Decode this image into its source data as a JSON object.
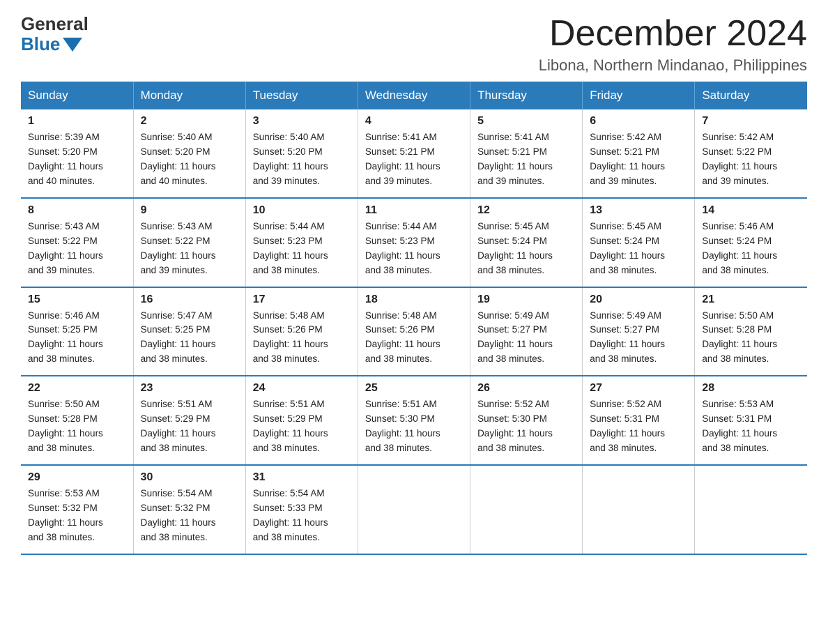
{
  "header": {
    "logo_general": "General",
    "logo_blue": "Blue",
    "title": "December 2024",
    "subtitle": "Libona, Northern Mindanao, Philippines"
  },
  "days_of_week": [
    "Sunday",
    "Monday",
    "Tuesday",
    "Wednesday",
    "Thursday",
    "Friday",
    "Saturday"
  ],
  "weeks": [
    [
      {
        "day": "1",
        "sunrise": "5:39 AM",
        "sunset": "5:20 PM",
        "daylight": "11 hours and 40 minutes."
      },
      {
        "day": "2",
        "sunrise": "5:40 AM",
        "sunset": "5:20 PM",
        "daylight": "11 hours and 40 minutes."
      },
      {
        "day": "3",
        "sunrise": "5:40 AM",
        "sunset": "5:20 PM",
        "daylight": "11 hours and 39 minutes."
      },
      {
        "day": "4",
        "sunrise": "5:41 AM",
        "sunset": "5:21 PM",
        "daylight": "11 hours and 39 minutes."
      },
      {
        "day": "5",
        "sunrise": "5:41 AM",
        "sunset": "5:21 PM",
        "daylight": "11 hours and 39 minutes."
      },
      {
        "day": "6",
        "sunrise": "5:42 AM",
        "sunset": "5:21 PM",
        "daylight": "11 hours and 39 minutes."
      },
      {
        "day": "7",
        "sunrise": "5:42 AM",
        "sunset": "5:22 PM",
        "daylight": "11 hours and 39 minutes."
      }
    ],
    [
      {
        "day": "8",
        "sunrise": "5:43 AM",
        "sunset": "5:22 PM",
        "daylight": "11 hours and 39 minutes."
      },
      {
        "day": "9",
        "sunrise": "5:43 AM",
        "sunset": "5:22 PM",
        "daylight": "11 hours and 39 minutes."
      },
      {
        "day": "10",
        "sunrise": "5:44 AM",
        "sunset": "5:23 PM",
        "daylight": "11 hours and 38 minutes."
      },
      {
        "day": "11",
        "sunrise": "5:44 AM",
        "sunset": "5:23 PM",
        "daylight": "11 hours and 38 minutes."
      },
      {
        "day": "12",
        "sunrise": "5:45 AM",
        "sunset": "5:24 PM",
        "daylight": "11 hours and 38 minutes."
      },
      {
        "day": "13",
        "sunrise": "5:45 AM",
        "sunset": "5:24 PM",
        "daylight": "11 hours and 38 minutes."
      },
      {
        "day": "14",
        "sunrise": "5:46 AM",
        "sunset": "5:24 PM",
        "daylight": "11 hours and 38 minutes."
      }
    ],
    [
      {
        "day": "15",
        "sunrise": "5:46 AM",
        "sunset": "5:25 PM",
        "daylight": "11 hours and 38 minutes."
      },
      {
        "day": "16",
        "sunrise": "5:47 AM",
        "sunset": "5:25 PM",
        "daylight": "11 hours and 38 minutes."
      },
      {
        "day": "17",
        "sunrise": "5:48 AM",
        "sunset": "5:26 PM",
        "daylight": "11 hours and 38 minutes."
      },
      {
        "day": "18",
        "sunrise": "5:48 AM",
        "sunset": "5:26 PM",
        "daylight": "11 hours and 38 minutes."
      },
      {
        "day": "19",
        "sunrise": "5:49 AM",
        "sunset": "5:27 PM",
        "daylight": "11 hours and 38 minutes."
      },
      {
        "day": "20",
        "sunrise": "5:49 AM",
        "sunset": "5:27 PM",
        "daylight": "11 hours and 38 minutes."
      },
      {
        "day": "21",
        "sunrise": "5:50 AM",
        "sunset": "5:28 PM",
        "daylight": "11 hours and 38 minutes."
      }
    ],
    [
      {
        "day": "22",
        "sunrise": "5:50 AM",
        "sunset": "5:28 PM",
        "daylight": "11 hours and 38 minutes."
      },
      {
        "day": "23",
        "sunrise": "5:51 AM",
        "sunset": "5:29 PM",
        "daylight": "11 hours and 38 minutes."
      },
      {
        "day": "24",
        "sunrise": "5:51 AM",
        "sunset": "5:29 PM",
        "daylight": "11 hours and 38 minutes."
      },
      {
        "day": "25",
        "sunrise": "5:51 AM",
        "sunset": "5:30 PM",
        "daylight": "11 hours and 38 minutes."
      },
      {
        "day": "26",
        "sunrise": "5:52 AM",
        "sunset": "5:30 PM",
        "daylight": "11 hours and 38 minutes."
      },
      {
        "day": "27",
        "sunrise": "5:52 AM",
        "sunset": "5:31 PM",
        "daylight": "11 hours and 38 minutes."
      },
      {
        "day": "28",
        "sunrise": "5:53 AM",
        "sunset": "5:31 PM",
        "daylight": "11 hours and 38 minutes."
      }
    ],
    [
      {
        "day": "29",
        "sunrise": "5:53 AM",
        "sunset": "5:32 PM",
        "daylight": "11 hours and 38 minutes."
      },
      {
        "day": "30",
        "sunrise": "5:54 AM",
        "sunset": "5:32 PM",
        "daylight": "11 hours and 38 minutes."
      },
      {
        "day": "31",
        "sunrise": "5:54 AM",
        "sunset": "5:33 PM",
        "daylight": "11 hours and 38 minutes."
      },
      null,
      null,
      null,
      null
    ]
  ],
  "labels": {
    "sunrise": "Sunrise:",
    "sunset": "Sunset:",
    "daylight": "Daylight:"
  }
}
